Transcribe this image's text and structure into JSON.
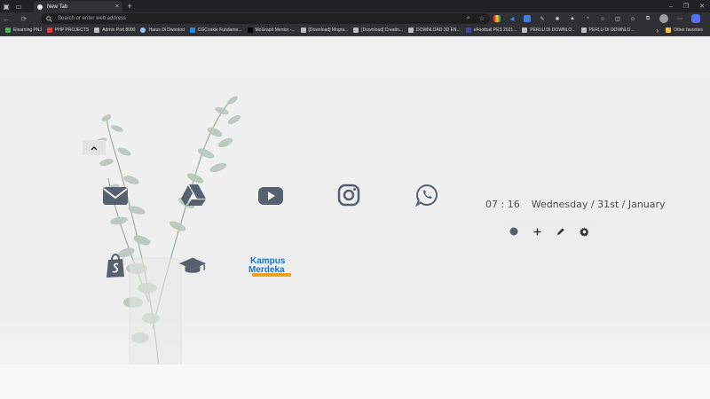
{
  "window": {
    "tab_title": "New Tab",
    "tab_close": "×",
    "new_tab": "+",
    "controls": [
      "–",
      "❐",
      "✕"
    ]
  },
  "toolbar": {
    "address_placeholder": "Search or enter web address",
    "extensions": [
      "grid-icon",
      "flag-icon",
      "box-icon",
      "pen-icon",
      "puzzle-icon",
      "triangle-icon",
      "circle-icon",
      "star-icon",
      "split-icon",
      "favorites-icon",
      "collections-icon",
      "profile-icon",
      "more-icon",
      "copilot-icon"
    ]
  },
  "bookmarks": [
    {
      "label": "Elearning PNJ",
      "color": "#4caf50"
    },
    {
      "label": "PHP PROJECTS",
      "color": "#e53935"
    },
    {
      "label": "Admin Port 8000",
      "color": "#bdbdbd"
    },
    {
      "label": "Harus Di Dwonlod",
      "color": "#90caf9"
    },
    {
      "label": "CGCookie Fundame...",
      "color": "#1e88e5"
    },
    {
      "label": "MoGraph Mentor -...",
      "color": "#000000"
    },
    {
      "label": "[Download] Mogra...",
      "color": "#bdbdbd"
    },
    {
      "label": "[Download] Creatin...",
      "color": "#bdbdbd"
    },
    {
      "label": "DOWNLOAD 3D EN...",
      "color": "#bdbdbd"
    },
    {
      "label": "eFootball PES 2021...",
      "color": "#3949ab"
    },
    {
      "label": "PERLU DI DOWNLO...",
      "color": "#bdbdbd"
    },
    {
      "label": "PERLU DI DOWNLO...",
      "color": "#bdbdbd"
    }
  ],
  "bookmarks_more": "›",
  "other_favorites": "Other favorites",
  "shortcuts": [
    {
      "name": "mail-icon"
    },
    {
      "name": "google-drive-icon"
    },
    {
      "name": "youtube-icon"
    },
    {
      "name": "instagram-icon"
    },
    {
      "name": "whatsapp-icon"
    },
    {
      "name": "shopify-icon"
    },
    {
      "name": "graduation-cap-icon"
    },
    {
      "name": "kampus-merdeka-logo",
      "text": "Kampus Merdeka"
    }
  ],
  "clock": {
    "time": "07 : 16",
    "date": "Wednesday / 31st / January"
  },
  "colors": {
    "icon": "#56606e",
    "clock_text": "#4b4b4b",
    "merdeka_blue": "#1a73c9",
    "merdeka_orange": "#f0a11b"
  }
}
